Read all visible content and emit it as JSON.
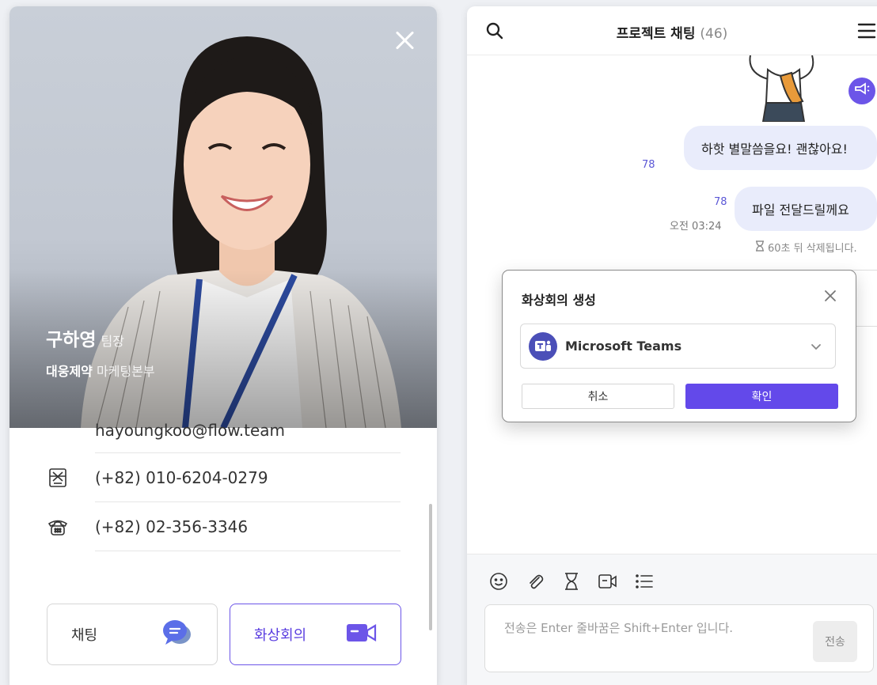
{
  "profile": {
    "name": "구하영",
    "title": "팀장",
    "company": "대웅제약",
    "department": "마케팅본부",
    "email": "hayoungkoo@flow.team",
    "mobile": "(+82) 010-6204-0279",
    "phone": "(+82) 02-356-3346",
    "chat_button": "채팅",
    "video_button": "화상회의"
  },
  "chat": {
    "title": "프로젝트 채팅",
    "count": "(46)",
    "messages": [
      {
        "text": "하핫 별말씀을요! 괜찮아요!",
        "read": "78"
      },
      {
        "text": "파일 전달드릴께요",
        "read": "78",
        "time": "오전 03:24"
      }
    ],
    "expire_notice": "60초 뒤 삭제됩니다.",
    "input_placeholder": "전송은 Enter 줄바꿈은 Shift+Enter 입니다.",
    "send_label": "전송"
  },
  "modal": {
    "title": "화상회의 생성",
    "selected_app": "Microsoft Teams",
    "cancel_label": "취소",
    "confirm_label": "확인"
  },
  "colors": {
    "accent": "#6349ea",
    "bubble": "#e9ecfb",
    "read_count": "#5b57d6"
  }
}
